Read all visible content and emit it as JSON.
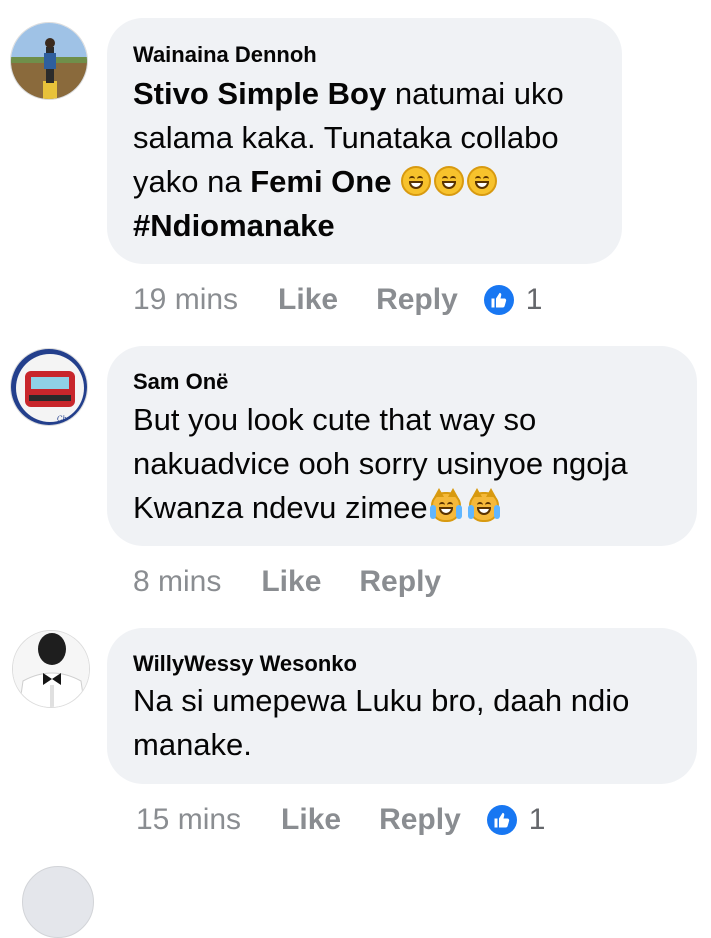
{
  "comments": [
    {
      "author": "Wainaina Dennoh",
      "lines": [
        {
          "bold1": "Stivo Simple Boy",
          "text1": " natumai uko"
        },
        {
          "text1": "salama kaka. Tunataka collabo"
        },
        {
          "text1": "yako na ",
          "bold1": "Femi One"
        },
        {
          "bold1": "#Ndiomanake"
        }
      ],
      "emojis": [
        "grinning-squinting-face",
        "grinning-squinting-face",
        "grinning-squinting-face"
      ],
      "time": "19 mins",
      "like_label": "Like",
      "reply_label": "Reply",
      "reaction_count": "1"
    },
    {
      "author": "Sam Onë",
      "lines": [
        {
          "text1": "But you look cute that way so"
        },
        {
          "text1": "nakuadvice ooh sorry usinyoe ngoja"
        },
        {
          "text1": "Kwanza ndevu zimee"
        }
      ],
      "emojis": [
        "cat-with-tears-of-joy",
        "cat-with-tears-of-joy"
      ],
      "time": "8 mins",
      "like_label": "Like",
      "reply_label": "Reply"
    },
    {
      "author": "WillyWessy Wesonko",
      "lines": [
        {
          "text1": "Na si umepewa Luku bro, daah ndio"
        },
        {
          "text1": "manake."
        }
      ],
      "time": "15 mins",
      "like_label": "Like",
      "reply_label": "Reply",
      "reaction_count": "1"
    }
  ],
  "colors": {
    "bubble": "#f0f2f5",
    "meta_text": "#8a8d91",
    "like_badge": "#1877f2"
  }
}
